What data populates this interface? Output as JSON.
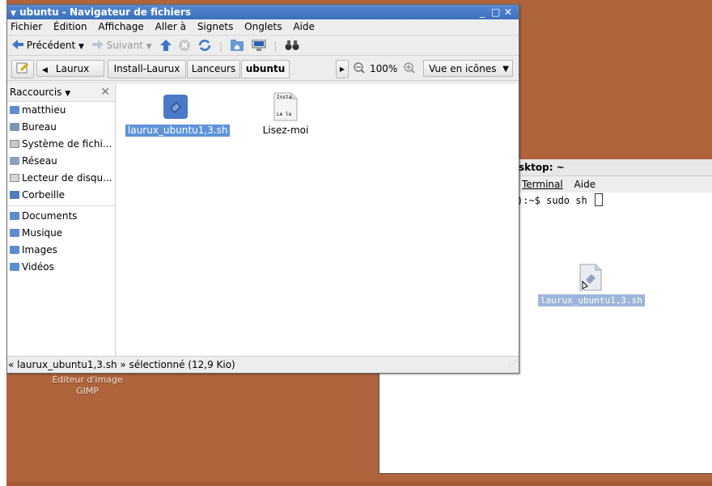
{
  "desktop": {
    "icons": [
      {
        "label_line1": "Éditeur d'image",
        "label_line2": "GIMP"
      }
    ]
  },
  "terminal": {
    "title": "sktop: ~",
    "menu": [
      "Terminal",
      "Aide"
    ],
    "prompt_line": "):~$ sudo sh ",
    "dragged_icon_label": "laurux_ubuntu1,3.sh"
  },
  "file_manager": {
    "title": "ubuntu - Navigateur de fichiers",
    "window_buttons": [
      "_",
      "□",
      "✕"
    ],
    "menu": [
      "Fichier",
      "Édition",
      "Affichage",
      "Aller à",
      "Signets",
      "Onglets",
      "Aide"
    ],
    "toolbar": {
      "back": "Précédent",
      "forward": "Suivant"
    },
    "location": {
      "crumbs": [
        "Laurux",
        "Install-Laurux",
        "Lanceurs",
        "ubuntu"
      ],
      "zoom": "100%",
      "view": "Vue en icônes"
    },
    "sidebar": {
      "header": "Raccourcis",
      "items": [
        "matthieu",
        "Bureau",
        "Système de fichi...",
        "Réseau",
        "Lecteur de disqu...",
        "Corbeille"
      ],
      "bookmarks": [
        "Documents",
        "Musique",
        "Images",
        "Vidéos"
      ]
    },
    "files": [
      {
        "name": "laurux_ubuntu1,3.sh",
        "selected": true
      },
      {
        "name": "Lisez-moi",
        "selected": false,
        "preview_line1": "Insta",
        "preview_line2": "Le la"
      }
    ],
    "status": "« laurux_ubuntu1,3.sh » sélectionné (12,9 Kio)"
  }
}
